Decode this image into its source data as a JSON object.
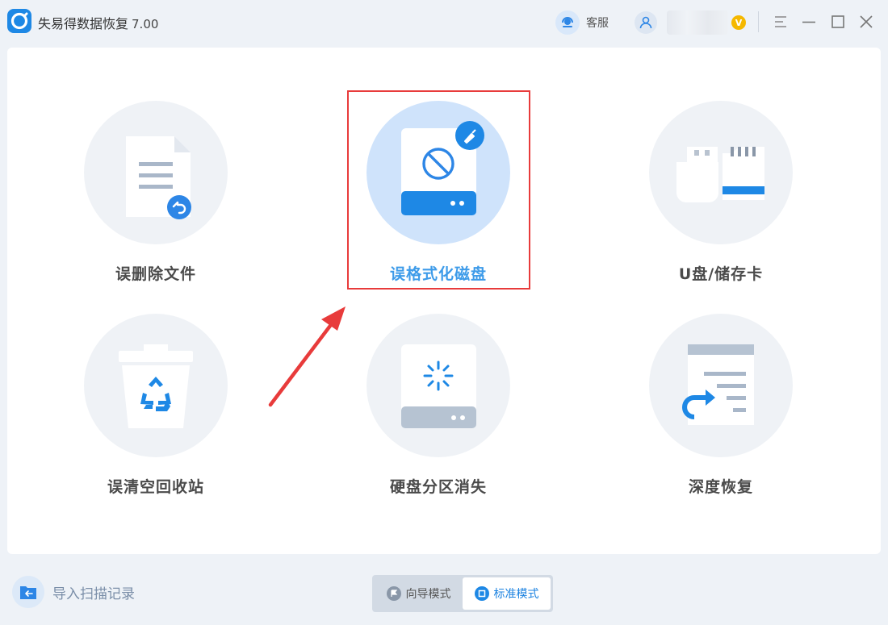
{
  "app": {
    "title": "失易得数据恢复",
    "version": "7.00"
  },
  "header": {
    "support_label": "客服",
    "vip_badge": "V"
  },
  "tiles": [
    {
      "label": "误删除文件",
      "icon": "deleted-file-icon"
    },
    {
      "label": "误格式化磁盘",
      "icon": "formatted-disk-icon",
      "active": true
    },
    {
      "label": "U盘/储存卡",
      "icon": "usb-sdcard-icon"
    },
    {
      "label": "误清空回收站",
      "icon": "recycle-bin-icon"
    },
    {
      "label": "硬盘分区消失",
      "icon": "lost-partition-icon"
    },
    {
      "label": "深度恢复",
      "icon": "deep-recovery-icon"
    }
  ],
  "footer": {
    "import_label": "导入扫描记录",
    "modes": [
      {
        "label": "向导模式",
        "icon": "flag-icon",
        "selected": false
      },
      {
        "label": "标准模式",
        "icon": "window-icon",
        "selected": true
      }
    ]
  },
  "colors": {
    "accent": "#1e88e5",
    "active_label": "#3d9be9",
    "highlight": "#e83b3b"
  }
}
